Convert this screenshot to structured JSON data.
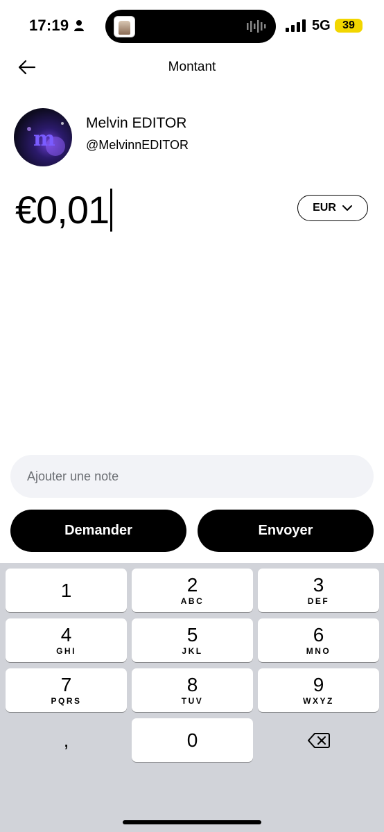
{
  "status_bar": {
    "time": "17:19",
    "network": "5G",
    "battery": "39"
  },
  "header": {
    "title": "Montant"
  },
  "recipient": {
    "name": "Melvin EDITOR",
    "handle": "@MelvinnEDITOR"
  },
  "amount": {
    "value": "€0,01",
    "currency": "EUR"
  },
  "note": {
    "placeholder": "Ajouter une note",
    "value": ""
  },
  "actions": {
    "request_label": "Demander",
    "send_label": "Envoyer"
  },
  "keypad": {
    "keys": [
      {
        "digit": "1",
        "letters": ""
      },
      {
        "digit": "2",
        "letters": "ABC"
      },
      {
        "digit": "3",
        "letters": "DEF"
      },
      {
        "digit": "4",
        "letters": "GHI"
      },
      {
        "digit": "5",
        "letters": "JKL"
      },
      {
        "digit": "6",
        "letters": "MNO"
      },
      {
        "digit": "7",
        "letters": "PQRS"
      },
      {
        "digit": "8",
        "letters": "TUV"
      },
      {
        "digit": "9",
        "letters": "WXYZ"
      },
      {
        "digit": ",",
        "letters": ""
      },
      {
        "digit": "0",
        "letters": ""
      }
    ],
    "backspace_icon": "backspace-icon"
  },
  "colors": {
    "button_bg": "#000000",
    "keypad_bg": "#d1d3d9",
    "note_bg": "#f2f3f7",
    "battery": "#f2d600"
  }
}
